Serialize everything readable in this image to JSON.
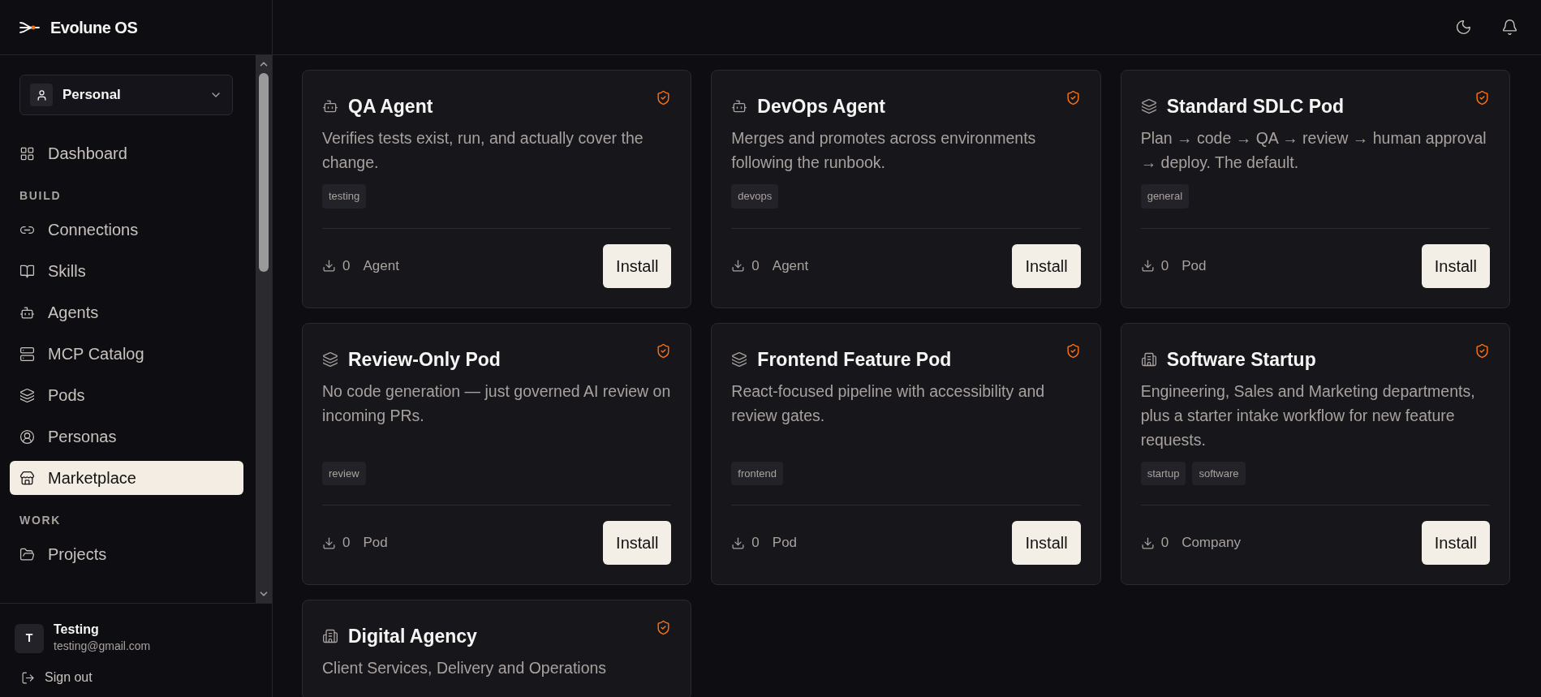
{
  "app": {
    "name": "Evolune OS"
  },
  "workspace": {
    "label": "Personal"
  },
  "nav_sections": [
    {
      "items": [
        {
          "kind": "dashboard",
          "label": "Dashboard",
          "selected": false
        }
      ]
    },
    {
      "heading": "BUILD",
      "items": [
        {
          "kind": "connections",
          "label": "Connections",
          "selected": false
        },
        {
          "kind": "skills",
          "label": "Skills",
          "selected": false
        },
        {
          "kind": "agents",
          "label": "Agents",
          "selected": false
        },
        {
          "kind": "catalog",
          "label": "MCP Catalog",
          "selected": false
        },
        {
          "kind": "pods",
          "label": "Pods",
          "selected": false
        },
        {
          "kind": "personas",
          "label": "Personas",
          "selected": false
        },
        {
          "kind": "marketplace",
          "label": "Marketplace",
          "selected": true
        }
      ]
    },
    {
      "heading": "WORK",
      "items": [
        {
          "kind": "projects",
          "label": "Projects",
          "selected": false
        }
      ]
    }
  ],
  "user": {
    "initial": "T",
    "name": "Testing",
    "email": "testing@gmail.com"
  },
  "sign_out": "Sign out",
  "cards": [
    {
      "kind": "agent",
      "title": "QA Agent",
      "verified": true,
      "description": "Verifies tests exist, run, and actually cover the change.",
      "tags": [
        "testing"
      ],
      "installs": "0",
      "type": "Agent",
      "button": "Install"
    },
    {
      "kind": "agent",
      "title": "DevOps Agent",
      "verified": true,
      "description": "Merges and promotes across environments following the runbook.",
      "tags": [
        "devops"
      ],
      "installs": "0",
      "type": "Agent",
      "button": "Install"
    },
    {
      "kind": "pod",
      "title": "Standard SDLC Pod",
      "verified": true,
      "description": "Plan → code → QA → review → human approval → deploy. The default.",
      "tags": [
        "general"
      ],
      "installs": "0",
      "type": "Pod",
      "button": "Install"
    },
    {
      "kind": "pod",
      "title": "Review-Only Pod",
      "verified": true,
      "description": "No code generation — just governed AI review on incoming PRs.",
      "tags": [
        "review"
      ],
      "installs": "0",
      "type": "Pod",
      "button": "Install"
    },
    {
      "kind": "pod",
      "title": "Frontend Feature Pod",
      "verified": true,
      "description": "React-focused pipeline with accessibility and review gates.",
      "tags": [
        "frontend"
      ],
      "installs": "0",
      "type": "Pod",
      "button": "Install"
    },
    {
      "kind": "company",
      "title": "Software Startup",
      "verified": true,
      "description": "Engineering, Sales and Marketing departments, plus a starter intake workflow for new feature requests.",
      "tags": [
        "startup",
        "software"
      ],
      "installs": "0",
      "type": "Company",
      "button": "Install"
    },
    {
      "kind": "company",
      "title": "Digital Agency",
      "verified": true,
      "description": "Client Services, Delivery and Operations"
    }
  ]
}
